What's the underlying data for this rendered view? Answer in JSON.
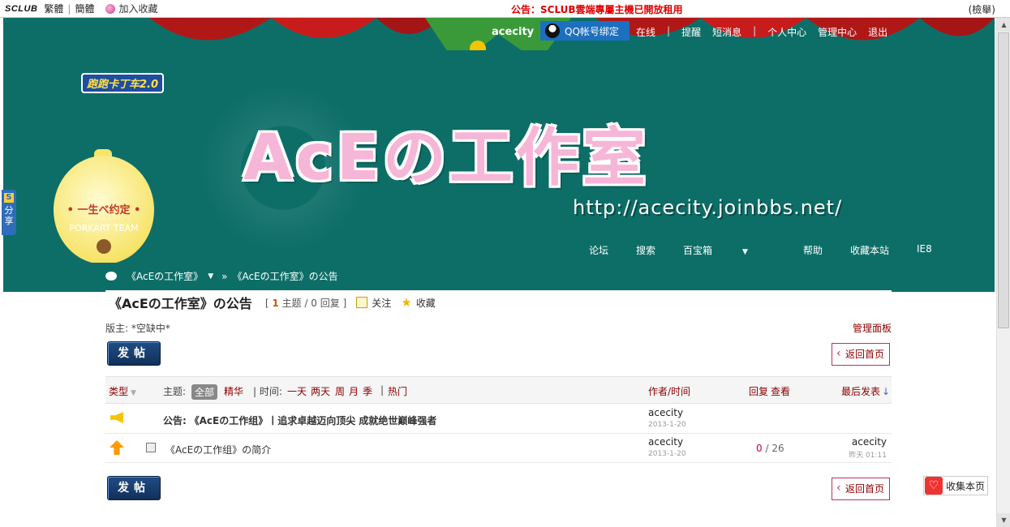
{
  "topbar": {
    "logo": "SCLUB",
    "traditional": "繁體",
    "simplified": "簡體",
    "favorite": "加入收藏",
    "announcement": "公告：SCLUB雲端專屬主機已開放租用",
    "search": "(檢舉)"
  },
  "header": {
    "game_logo": "跑跑卡丁车2.0",
    "bell_text": "• 一生べ约定 •",
    "bell_team": "PORKART TEAM",
    "site_title": "AcEの工作室",
    "site_url": "http://acecity.joinbbs.net/",
    "username": "acecity",
    "qq_bind": "QQ帐号绑定",
    "user_nav": [
      "在线",
      "|",
      "提醒",
      "短消息",
      "|",
      "个人中心",
      "管理中心",
      "退出"
    ],
    "main_nav": [
      "论坛",
      "搜索",
      "百宝箱",
      "帮助",
      "收藏本站",
      "IE8"
    ]
  },
  "share": {
    "label_top": "分",
    "label_bottom": "享"
  },
  "breadcrumb": {
    "forum": "《AcEの工作室》",
    "sep": "»",
    "current": "《AcEの工作室》の公告"
  },
  "forum": {
    "title": "《AcEの工作室》の公告",
    "stats_open": "[",
    "topics_num": "1",
    "topics_label": "主题",
    "stats_sep": "/",
    "replies_num": "0",
    "replies_label": "回复",
    "stats_close": "]",
    "follow": "关注",
    "favorite": "收藏",
    "moderator": "版主: *空缺中*",
    "admin_panel": "管理面板",
    "post_button": "发帖",
    "back_button": "返回首页"
  },
  "filter": {
    "type": "类型",
    "topic_label": "主题:",
    "all": "全部",
    "digest": "精华",
    "time_label": "| 时间:",
    "day": "一天",
    "two_days": "两天",
    "week": "周",
    "month": "月",
    "season": "季",
    "hot": "热门",
    "author_time": "作者/时间",
    "reply": "回复",
    "view": "查看",
    "last_post": "最后发表"
  },
  "threads": [
    {
      "prefix": "公告:",
      "title": "《AcEの工作组》丨追求卓越迈向顶尖 成就绝世巅峰强者",
      "author": "acecity",
      "date": "2013-1-20",
      "replies": "",
      "views": "",
      "last_author": "",
      "last_date": ""
    },
    {
      "prefix": "",
      "title": "《AcEの工作组》の简介",
      "author": "acecity",
      "date": "2013-1-20",
      "replies": "0",
      "slash": "/",
      "views": "26",
      "last_author": "acecity",
      "last_date": "昨天 01:11"
    }
  ],
  "collect": {
    "label": "收集本页"
  },
  "colors": {
    "teal": "#0d6e68",
    "accent_red": "#8b0000",
    "announce_red": "#dd0000"
  }
}
